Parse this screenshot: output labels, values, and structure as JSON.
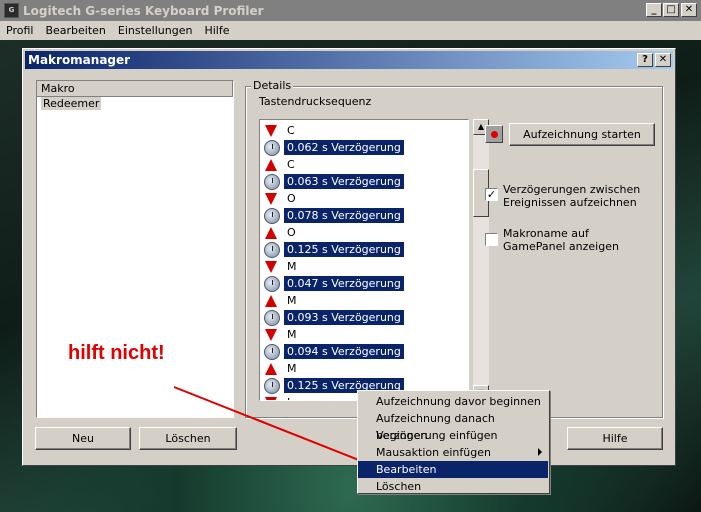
{
  "app": {
    "title": "Logitech G-series Keyboard Profiler",
    "icon_text": "G",
    "window_buttons": {
      "minimize": "_",
      "maximize": "□",
      "close": "✕"
    }
  },
  "menubar": [
    "Profil",
    "Bearbeiten",
    "Einstellungen",
    "Hilfe"
  ],
  "dialog": {
    "title": "Makromanager",
    "help_button": "?",
    "close_button": "✕",
    "list": {
      "header": "Makro",
      "items": [
        "Redeemer"
      ]
    },
    "details_label": "Details",
    "sequence_label": "Tastendrucksequenz",
    "sequence": [
      {
        "kind": "down",
        "text": "C"
      },
      {
        "kind": "delay",
        "text": "0.062 s Verzögerung"
      },
      {
        "kind": "up",
        "text": "C"
      },
      {
        "kind": "delay",
        "text": "0.063 s Verzögerung"
      },
      {
        "kind": "down",
        "text": "O"
      },
      {
        "kind": "delay",
        "text": "0.078 s Verzögerung"
      },
      {
        "kind": "up",
        "text": "O"
      },
      {
        "kind": "delay",
        "text": "0.125 s Verzögerung"
      },
      {
        "kind": "down",
        "text": "M"
      },
      {
        "kind": "delay",
        "text": "0.047 s Verzögerung"
      },
      {
        "kind": "up",
        "text": "M"
      },
      {
        "kind": "delay",
        "text": "0.093 s Verzögerung"
      },
      {
        "kind": "down",
        "text": "M"
      },
      {
        "kind": "delay",
        "text": "0.094 s Verzögerung"
      },
      {
        "kind": "up",
        "text": "M"
      },
      {
        "kind": "delay",
        "text": "0.125 s Verzögerung"
      },
      {
        "kind": "down",
        "text": "I"
      }
    ],
    "record_button": "Aufzeichnung starten",
    "checkbox_delays": {
      "label": "Verzögerungen zwischen Ereignissen aufzeichnen",
      "checked": true,
      "mark": "✓"
    },
    "checkbox_gamepanel": {
      "label": "Makroname auf GamePanel anzeigen",
      "checked": false
    },
    "buttons": {
      "new": "Neu",
      "delete": "Löschen",
      "help": "Hilfe"
    }
  },
  "annotation": {
    "text": "hilft nicht!",
    "color": "#e00000"
  },
  "context_menu": {
    "items": [
      {
        "label": "Aufzeichnung davor beginnen"
      },
      {
        "label": "Aufzeichnung danach beginnen"
      },
      {
        "label": "Verzögerung einfügen"
      },
      {
        "label": "Mausaktion einfügen",
        "submenu": true
      },
      {
        "label": "Bearbeiten",
        "highlighted": true
      },
      {
        "label": "Löschen"
      }
    ]
  }
}
